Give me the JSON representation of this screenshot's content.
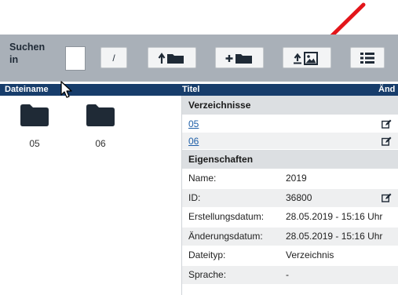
{
  "toolbar": {
    "search_label": "Suchen\nin",
    "slash_label": "/",
    "buttons": {
      "root": "slash-button",
      "up": "folder-up-icon",
      "new_folder": "folder-plus-icon",
      "upload_image": "image-upload-icon",
      "list_view": "list-icon"
    }
  },
  "header": {
    "col_filename": "Dateiname",
    "col_title": "Titel",
    "col_changed": "Änd"
  },
  "folders": [
    {
      "name": "05"
    },
    {
      "name": "06"
    }
  ],
  "details": {
    "directories_heading": "Verzeichnisse",
    "directories": [
      {
        "label": "05"
      },
      {
        "label": "06"
      }
    ],
    "properties_heading": "Eigenschaften",
    "properties": [
      {
        "key": "Name:",
        "value": "2019"
      },
      {
        "key": "ID:",
        "value": "36800"
      },
      {
        "key": "Erstellungsdatum:",
        "value": "28.05.2019 - 15:16 Uhr"
      },
      {
        "key": "Änderungsdatum:",
        "value": "28.05.2019 - 15:16 Uhr"
      },
      {
        "key": "Dateityp:",
        "value": "Verzeichnis"
      },
      {
        "key": "Sprache:",
        "value": "-"
      }
    ]
  },
  "colors": {
    "toolbar_bg": "#a9b0b8",
    "header_bg": "#173d6b",
    "link": "#1f5fa8",
    "annotation_arrow": "#e3151a"
  }
}
